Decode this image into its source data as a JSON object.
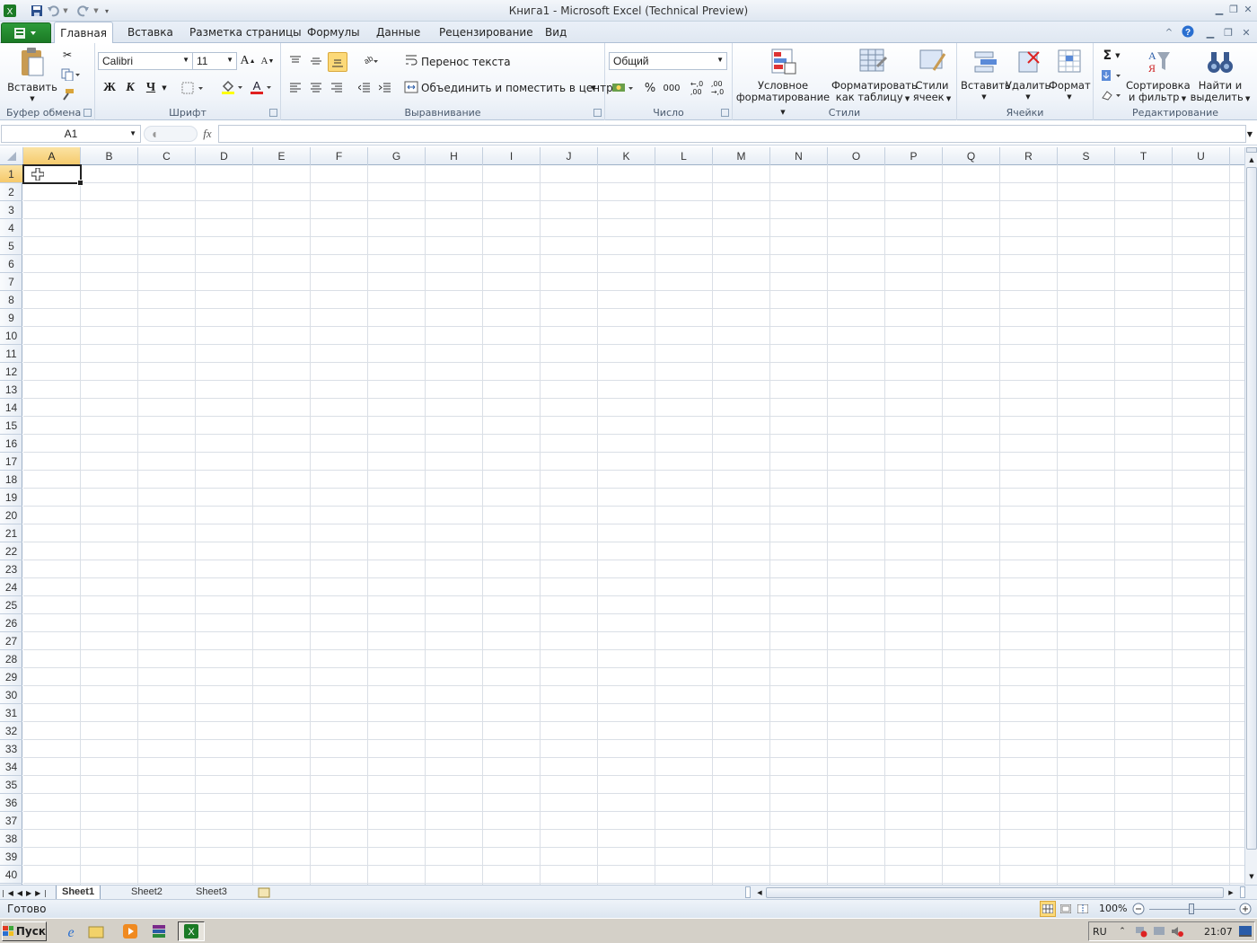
{
  "window": {
    "title": "Книга1 - Microsoft Excel (Technical Preview)"
  },
  "ribbon_tabs": [
    "Главная",
    "Вставка",
    "Разметка страницы",
    "Формулы",
    "Данные",
    "Рецензирование",
    "Вид"
  ],
  "clipboard": {
    "paste": "Вставить",
    "group": "Буфер обмена"
  },
  "font": {
    "name": "Calibri",
    "size": "11",
    "bold": "Ж",
    "italic": "К",
    "underline": "Ч",
    "grow": "A",
    "shrink": "A",
    "fontcolor": "A",
    "group": "Шрифт"
  },
  "alignment": {
    "wrap": "Перенос текста",
    "merge": "Объединить и поместить в центре",
    "group": "Выравнивание"
  },
  "number": {
    "format": "Общий",
    "percent": "%",
    "thousands": "000",
    "group": "Число"
  },
  "styles": {
    "cond_line1": "Условное",
    "cond_line2": "форматирование",
    "table_line1": "Форматировать",
    "table_line2": "как таблицу",
    "cell_line1": "Стили",
    "cell_line2": "ячеек",
    "group": "Стили"
  },
  "cells": {
    "insert": "Вставить",
    "delete": "Удалить",
    "format": "Формат",
    "group": "Ячейки"
  },
  "editing": {
    "sum": "Σ",
    "sort_line1": "Сортировка",
    "sort_line2": "и фильтр",
    "find_line1": "Найти и",
    "find_line2": "выделить",
    "group": "Редактирование"
  },
  "formula_bar": {
    "name_box": "A1",
    "fx": "fx",
    "value": ""
  },
  "columns": [
    "A",
    "B",
    "C",
    "D",
    "E",
    "F",
    "G",
    "H",
    "I",
    "J",
    "K",
    "L",
    "M",
    "N",
    "O",
    "P",
    "Q",
    "R",
    "S",
    "T",
    "U"
  ],
  "rows": [
    "1",
    "2",
    "3",
    "4",
    "5",
    "6",
    "7",
    "8",
    "9",
    "10",
    "11",
    "12",
    "13",
    "14",
    "15",
    "16",
    "17",
    "18",
    "19",
    "20",
    "21",
    "22",
    "23",
    "24",
    "25",
    "26",
    "27",
    "28",
    "29",
    "30",
    "31",
    "32",
    "33",
    "34",
    "35",
    "36",
    "37",
    "38",
    "39",
    "40"
  ],
  "sheets": [
    "Sheet1",
    "Sheet2",
    "Sheet3"
  ],
  "status": {
    "ready": "Готово",
    "zoom": "100%"
  },
  "taskbar": {
    "start": "Пуск",
    "lang": "RU",
    "clock": "21:07"
  },
  "colors": {
    "accent": "#1b7a25",
    "selection_header": "#f5c96a",
    "grid": "#dadfe6"
  }
}
